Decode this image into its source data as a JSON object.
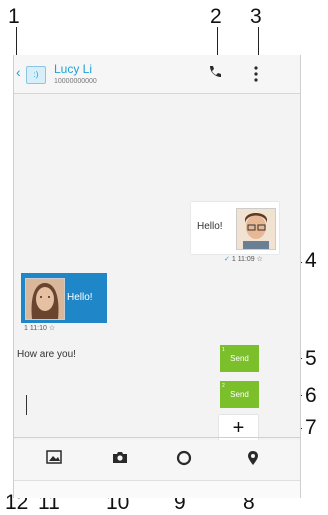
{
  "contact": {
    "name": "Lucy Li",
    "number": "10000000000",
    "icon_text": ":)"
  },
  "icons": {
    "back": "back-chevron-icon",
    "call": "phone-call-icon",
    "menu": "overflow-menu-icon",
    "gallery": "gallery-icon",
    "camera": "camera-icon",
    "location": "location-icon",
    "attach": "attach-icon",
    "add": "plus-icon"
  },
  "messages": {
    "outgoing": {
      "text": "Hello!",
      "check": "✓",
      "count": "1",
      "time": "11:09",
      "star": "☆"
    },
    "incoming": {
      "text": "Hello!",
      "count": "1",
      "time": "11:10",
      "star": "☆"
    }
  },
  "compose": {
    "text": "How are you!",
    "send_label": "Send",
    "send_label_2": "Send",
    "badge_1": "1",
    "badge_2": "2"
  },
  "add_button": {
    "label": "+"
  },
  "callouts": [
    "1",
    "2",
    "3",
    "4",
    "5",
    "6",
    "7",
    "8",
    "9",
    "10",
    "11",
    "12"
  ],
  "colors": {
    "accent": "#1ea2d8",
    "incoming_bubble": "#1f87c7",
    "send_button": "#7bbf2a"
  }
}
